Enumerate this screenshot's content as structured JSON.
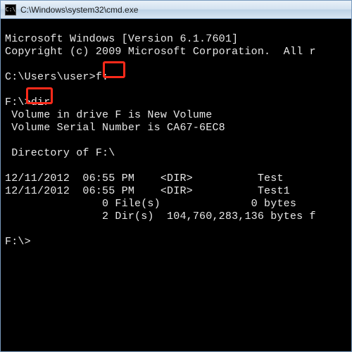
{
  "title": "C:\\Windows\\system32\\cmd.exe",
  "appicon_glyph": "C:\\",
  "lines": {
    "l0": "Microsoft Windows [Version 6.1.7601]",
    "l1": "Copyright (c) 2009 Microsoft Corporation.  All r",
    "l2": "",
    "l3a": "C:\\Users\\user>",
    "l3b": "f:",
    "l4": "",
    "l5a": "F:\\>",
    "l5b": "dir",
    "l6": " Volume in drive F is New Volume",
    "l7": " Volume Serial Number is CA67-6EC8",
    "l8": "",
    "l9": " Directory of F:\\",
    "l10": "",
    "l11": "12/11/2012  06:55 PM    <DIR>          Test",
    "l12": "12/11/2012  06:55 PM    <DIR>          Test1",
    "l13": "               0 File(s)              0 bytes",
    "l14": "               2 Dir(s)  104,760,283,136 bytes f",
    "l15": "",
    "l16": "F:\\>"
  },
  "highlights": {
    "h1_target": "f:",
    "h2_target": "dir"
  }
}
